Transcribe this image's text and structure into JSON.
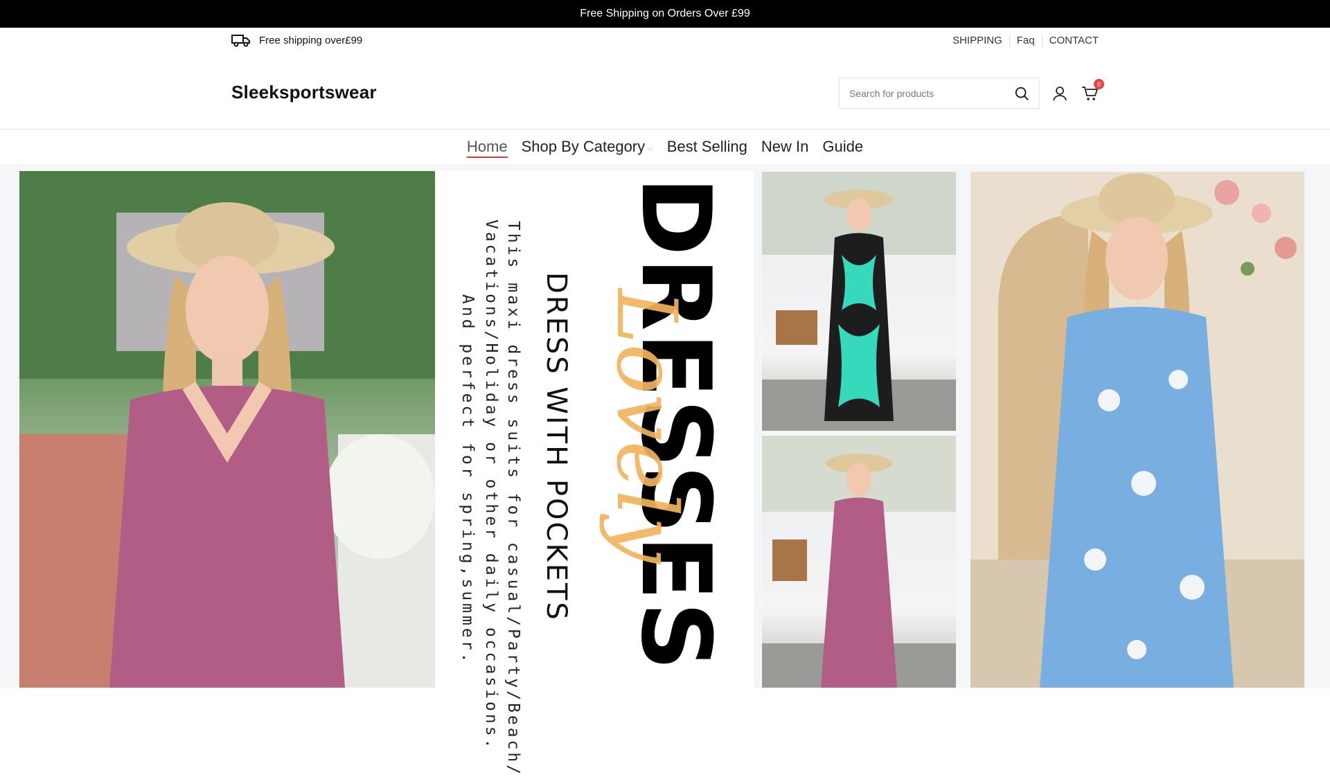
{
  "announcement": {
    "text": "Free Shipping on Orders Over £99"
  },
  "topbar": {
    "shipping_text": "Free shipping over£99",
    "links": [
      "SHIPPING",
      "Faq",
      "CONTACT"
    ]
  },
  "header": {
    "logo": "Sleeksportswear",
    "search_placeholder": "Search for products",
    "cart_count": "0"
  },
  "nav": {
    "items": [
      {
        "label": "Home",
        "active": true
      },
      {
        "label": "Shop By Category",
        "has_dropdown": true
      },
      {
        "label": "Best Selling"
      },
      {
        "label": "New In"
      },
      {
        "label": "Guide"
      }
    ]
  },
  "hero": {
    "headline": "DRESSES",
    "script_text": "Lovely",
    "subheadline": "DRESS WITH POCKETS",
    "description_lines": [
      "This maxi dress suits for casual/Party/Beach/",
      "Vacations/Holiday or other daily occasions.",
      "And perfect for spring,summer."
    ]
  },
  "colors": {
    "announcement_bg": "#000000",
    "accent_underline": "#d63c3c",
    "badge": "#e64545",
    "script_color": "#f1b45e"
  }
}
